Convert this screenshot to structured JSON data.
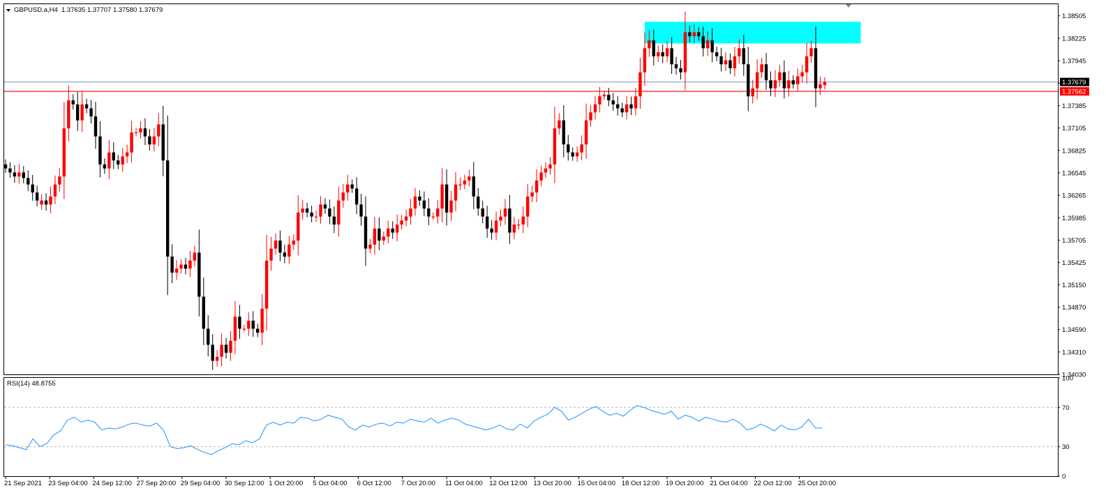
{
  "chart_data": {
    "type": "candlestick",
    "symbol_header": {
      "symbol": "GBPUSD.a,H4",
      "ohlc": "1.37635 1.37707 1.37580 1.37679"
    },
    "price_axis": {
      "ylim": [
        1.3403,
        1.3865
      ],
      "ticks": [
        "1.38505",
        "1.38225",
        "1.37945",
        "1.37665",
        "1.37385",
        "1.37105",
        "1.36825",
        "1.36545",
        "1.36265",
        "1.35985",
        "1.35705",
        "1.35425",
        "1.35150",
        "1.34870",
        "1.34590",
        "1.34310",
        "1.34030"
      ]
    },
    "time_axis_labels": [
      "21 Sep 2021",
      "23 Sep 04:00",
      "24 Sep 12:00",
      "27 Sep 20:00",
      "29 Sep 04:00",
      "30 Sep 12:00",
      "1 Oct 20:00",
      "5 Oct 04:00",
      "6 Oct 12:00",
      "7 Oct 20:00",
      "11 Oct 04:00",
      "12 Oct 12:00",
      "13 Oct 20:00",
      "15 Oct 04:00",
      "18 Oct 12:00",
      "19 Oct 20:00",
      "21 Oct 04:00",
      "22 Oct 12:00",
      "25 Oct 20:00"
    ],
    "current_price": {
      "value": 1.37679,
      "label": "1.37679",
      "color": "#7f97b2"
    },
    "horizontal_line": {
      "value": 1.37562,
      "label": "1.37562",
      "color": "#ff0000"
    },
    "resistance_zone": {
      "price_from": 1.3816,
      "price_to": 1.3843,
      "bar_from": 142,
      "bar_to": 190,
      "color": "#00ffff"
    },
    "bull_color": "#ff0000",
    "bear_color": "#000000",
    "candles_close": [
      1.366,
      1.3655,
      1.365,
      1.3655,
      1.3648,
      1.364,
      1.363,
      1.362,
      1.362,
      1.3615,
      1.3625,
      1.364,
      1.365,
      1.371,
      1.3745,
      1.374,
      1.372,
      1.374,
      1.3735,
      1.3725,
      1.37,
      1.3665,
      1.366,
      1.368,
      1.367,
      1.3665,
      1.3675,
      1.368,
      1.3705,
      1.3705,
      1.371,
      1.37,
      1.369,
      1.37,
      1.3715,
      1.367,
      1.355,
      1.353,
      1.3535,
      1.354,
      1.3535,
      1.3545,
      1.3555,
      1.35,
      1.346,
      1.344,
      1.342,
      1.3425,
      1.344,
      1.343,
      1.3445,
      1.3475,
      1.346,
      1.346,
      1.347,
      1.346,
      1.3455,
      1.3485,
      1.3545,
      1.356,
      1.357,
      1.3555,
      1.355,
      1.3565,
      1.357,
      1.3605,
      1.361,
      1.3605,
      1.36,
      1.36,
      1.3615,
      1.361,
      1.36,
      1.359,
      1.362,
      1.363,
      1.364,
      1.3635,
      1.3615,
      1.36,
      1.356,
      1.3565,
      1.3585,
      1.357,
      1.3575,
      1.3585,
      1.358,
      1.359,
      1.3595,
      1.36,
      1.361,
      1.3625,
      1.362,
      1.361,
      1.36,
      1.36,
      1.361,
      1.364,
      1.3605,
      1.362,
      1.364,
      1.364,
      1.3645,
      1.365,
      1.3625,
      1.361,
      1.36,
      1.3585,
      1.358,
      1.3595,
      1.36,
      1.361,
      1.358,
      1.359,
      1.359,
      1.36,
      1.3625,
      1.363,
      1.3645,
      1.3655,
      1.366,
      1.3665,
      1.371,
      1.372,
      1.369,
      1.368,
      1.3675,
      1.368,
      1.369,
      1.372,
      1.373,
      1.374,
      1.375,
      1.3752,
      1.3745,
      1.374,
      1.3735,
      1.373,
      1.374,
      1.3735,
      1.375,
      1.378,
      1.381,
      1.382,
      1.38,
      1.3805,
      1.38,
      1.381,
      1.379,
      1.3785,
      1.378,
      1.383,
      1.3825,
      1.383,
      1.3825,
      1.381,
      1.382,
      1.3805,
      1.38,
      1.379,
      1.3795,
      1.3785,
      1.38,
      1.381,
      1.379,
      1.375,
      1.376,
      1.378,
      1.379,
      1.377,
      1.376,
      1.377,
      1.378,
      1.376,
      1.377,
      1.3765,
      1.3775,
      1.378,
      1.38,
      1.381,
      1.376,
      1.3765,
      1.3768
    ],
    "candles_open": [
      1.3665,
      1.366,
      1.3655,
      1.365,
      1.3655,
      1.3648,
      1.364,
      1.363,
      1.3615,
      1.362,
      1.3615,
      1.3625,
      1.364,
      1.365,
      1.371,
      1.3745,
      1.374,
      1.372,
      1.374,
      1.3735,
      1.3725,
      1.37,
      1.3665,
      1.366,
      1.368,
      1.367,
      1.3665,
      1.3675,
      1.368,
      1.3705,
      1.3705,
      1.371,
      1.37,
      1.369,
      1.37,
      1.3715,
      1.367,
      1.355,
      1.353,
      1.3535,
      1.354,
      1.3535,
      1.3545,
      1.3555,
      1.35,
      1.346,
      1.344,
      1.342,
      1.3425,
      1.344,
      1.343,
      1.3445,
      1.3475,
      1.346,
      1.346,
      1.347,
      1.346,
      1.3455,
      1.3485,
      1.3545,
      1.356,
      1.357,
      1.3555,
      1.355,
      1.3565,
      1.357,
      1.3605,
      1.361,
      1.3605,
      1.36,
      1.36,
      1.3615,
      1.361,
      1.36,
      1.359,
      1.362,
      1.363,
      1.364,
      1.3635,
      1.3615,
      1.36,
      1.356,
      1.3565,
      1.3585,
      1.357,
      1.3575,
      1.3585,
      1.358,
      1.359,
      1.3595,
      1.36,
      1.361,
      1.3625,
      1.362,
      1.361,
      1.36,
      1.36,
      1.361,
      1.364,
      1.3605,
      1.362,
      1.364,
      1.364,
      1.3645,
      1.365,
      1.3625,
      1.361,
      1.36,
      1.3585,
      1.358,
      1.3595,
      1.36,
      1.361,
      1.358,
      1.359,
      1.359,
      1.36,
      1.3625,
      1.363,
      1.3645,
      1.3655,
      1.366,
      1.3665,
      1.371,
      1.372,
      1.369,
      1.368,
      1.3675,
      1.368,
      1.369,
      1.372,
      1.373,
      1.374,
      1.375,
      1.3752,
      1.3745,
      1.374,
      1.3735,
      1.373,
      1.374,
      1.3735,
      1.375,
      1.378,
      1.381,
      1.382,
      1.38,
      1.3805,
      1.38,
      1.381,
      1.379,
      1.3785,
      1.378,
      1.383,
      1.3825,
      1.383,
      1.3825,
      1.381,
      1.382,
      1.3805,
      1.38,
      1.379,
      1.3795,
      1.3785,
      1.38,
      1.381,
      1.379,
      1.375,
      1.376,
      1.378,
      1.379,
      1.377,
      1.376,
      1.377,
      1.378,
      1.376,
      1.377,
      1.3765,
      1.3775,
      1.378,
      1.38,
      1.381,
      1.376,
      1.3764
    ],
    "rsi": {
      "label": "RSI(14) 48.8755",
      "ylim": [
        0,
        100
      ],
      "levels": [
        30,
        70
      ],
      "ticks": [
        "100",
        "70",
        "30",
        "0"
      ],
      "color": "#1e90ff",
      "values": [
        32,
        31,
        29,
        27,
        38,
        30,
        33,
        42,
        46,
        57,
        60,
        55,
        57,
        55,
        47,
        49,
        48,
        50,
        53,
        54,
        52,
        51,
        54,
        47,
        30,
        28,
        29,
        31,
        27,
        24,
        22,
        26,
        29,
        33,
        32,
        36,
        34,
        38,
        52,
        55,
        52,
        55,
        54,
        60,
        59,
        56,
        58,
        62,
        60,
        58,
        50,
        47,
        52,
        50,
        53,
        54,
        51,
        55,
        54,
        58,
        56,
        55,
        59,
        54,
        57,
        59,
        57,
        53,
        51,
        49,
        47,
        49,
        52,
        48,
        47,
        53,
        49,
        56,
        60,
        63,
        70,
        66,
        57,
        60,
        64,
        68,
        71,
        66,
        62,
        64,
        61,
        67,
        72,
        70,
        67,
        65,
        63,
        66,
        58,
        62,
        60,
        56,
        60,
        58,
        56,
        55,
        58,
        54,
        47,
        49,
        53,
        50,
        46,
        52,
        48,
        47,
        50,
        58,
        49,
        49
      ]
    }
  }
}
